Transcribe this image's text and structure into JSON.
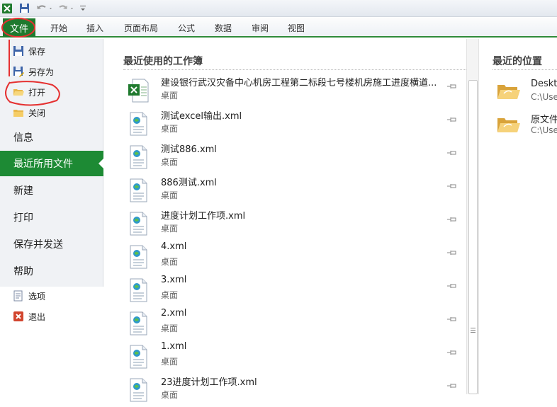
{
  "ribbon": {
    "file_tab": "文件",
    "tabs": [
      "开始",
      "插入",
      "页面布局",
      "公式",
      "数据",
      "审阅",
      "视图"
    ]
  },
  "left_menu": {
    "save": "保存",
    "save_as": "另存为",
    "open": "打开",
    "close": "关闭",
    "info": "信息",
    "recent": "最近所用文件",
    "new": "新建",
    "print": "打印",
    "save_send": "保存并发送",
    "help": "帮助",
    "options": "选项",
    "exit": "退出"
  },
  "recent_workbooks": {
    "title": "最近使用的工作簿",
    "files": [
      {
        "name": "建设银行武汉灾备中心机房工程第二标段七号楼机房施工进度横道...",
        "location": "桌面",
        "type": "xlsx"
      },
      {
        "name": "测试excel输出.xml",
        "location": "桌面",
        "type": "xml"
      },
      {
        "name": "测试886.xml",
        "location": "桌面",
        "type": "xml"
      },
      {
        "name": "886测试.xml",
        "location": "桌面",
        "type": "xml"
      },
      {
        "name": "进度计划工作项.xml",
        "location": "桌面",
        "type": "xml"
      },
      {
        "name": "4.xml",
        "location": "桌面",
        "type": "xml"
      },
      {
        "name": "3.xml",
        "location": "桌面",
        "type": "xml"
      },
      {
        "name": "2.xml",
        "location": "桌面",
        "type": "xml"
      },
      {
        "name": "1.xml",
        "location": "桌面",
        "type": "xml"
      },
      {
        "name": "23进度计划工作项.xml",
        "location": "桌面",
        "type": "xml"
      }
    ]
  },
  "recent_places": {
    "title": "最近的位置",
    "places": [
      {
        "name": "Deskto",
        "path": "C:\\Use"
      },
      {
        "name": "原文件",
        "path": "C:\\Use"
      }
    ]
  },
  "colors": {
    "accent": "#1d8a34",
    "annotation": "#e53030"
  }
}
